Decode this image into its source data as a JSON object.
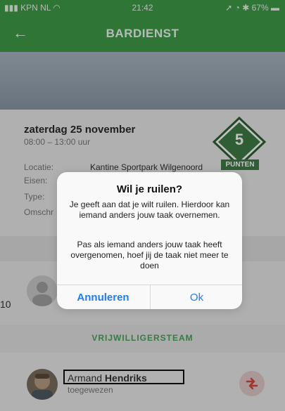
{
  "status": {
    "carrier": "KPN NL",
    "time": "21:42",
    "battery": "67%"
  },
  "header": {
    "title": "BARDIENST",
    "back_icon": "arrow-left-icon"
  },
  "task": {
    "date": "zaterdag 25 november",
    "time_range": "08:00 – 13:00 uur",
    "rows": [
      {
        "label": "Locatie:",
        "value": "Kantine Sportpark Wilgenoord"
      },
      {
        "label": "Eisen:",
        "value": ""
      },
      {
        "label": "Type:",
        "value": ""
      },
      {
        "label": "Omschr",
        "value": ""
      }
    ],
    "points": {
      "value": "5",
      "label": "PUNTEN",
      "color": "#3f7c46"
    }
  },
  "peek_text": "10",
  "team": {
    "header": "VRIJWILLIGERSTEAM",
    "member_first": "Armand",
    "member_last": "Hendriks",
    "member_role": "toegewezen",
    "swap_icon": "swap-arrows-icon"
  },
  "dialog": {
    "title": "Wil je ruilen?",
    "message1": "Je geeft aan dat je wilt ruilen. Hierdoor kan iemand anders jouw taak overnemen.",
    "message2": "Pas als iemand anders jouw taak heeft overgenomen, hoef jij de taak niet meer te doen",
    "cancel": "Annuleren",
    "ok": "Ok"
  },
  "colors": {
    "accent": "#3f9a48",
    "dialog_button": "#1e7ef0"
  }
}
